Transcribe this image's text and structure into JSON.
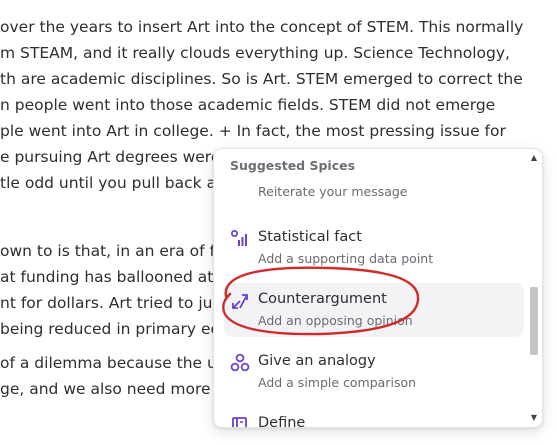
{
  "document": {
    "lines": [
      "over the years to insert Art into the concept of STEM. This normally",
      "m STEAM, and it really clouds everything up. Science Technology,",
      "th are academic disciplines. So is Art. STEM emerged to correct the",
      "n people went into those academic fields. STEM did not emerge",
      "ple went into Art in college. + In fact, the most pressing issue for",
      "e pursuing Art degrees were",
      "tle odd until you pull back a",
      "",
      "own to is that, in an era of fu",
      "at funding has ballooned at t",
      "nt for dollars. Art tried to jum",
      " being reduced in primary ec",
      "",
      "of a dilemma because the ult",
      "ge, and we also need more A"
    ]
  },
  "popup": {
    "header": "Suggested Spices",
    "partial_item_desc": "Reiterate your message",
    "items": [
      {
        "title": "Statistical fact",
        "desc": "Add a supporting data point",
        "icon": "bar-chart-icon"
      },
      {
        "title": "Counterargument",
        "desc": "Add an opposing opinion",
        "icon": "swap-arrows-icon"
      },
      {
        "title": "Give an analogy",
        "desc": "Add a simple comparison",
        "icon": "shapes-icon"
      },
      {
        "title": "Define",
        "desc": "",
        "icon": "book-icon"
      }
    ],
    "accent_color": "#6a3fd1",
    "annotation_color": "#d12a2a"
  }
}
